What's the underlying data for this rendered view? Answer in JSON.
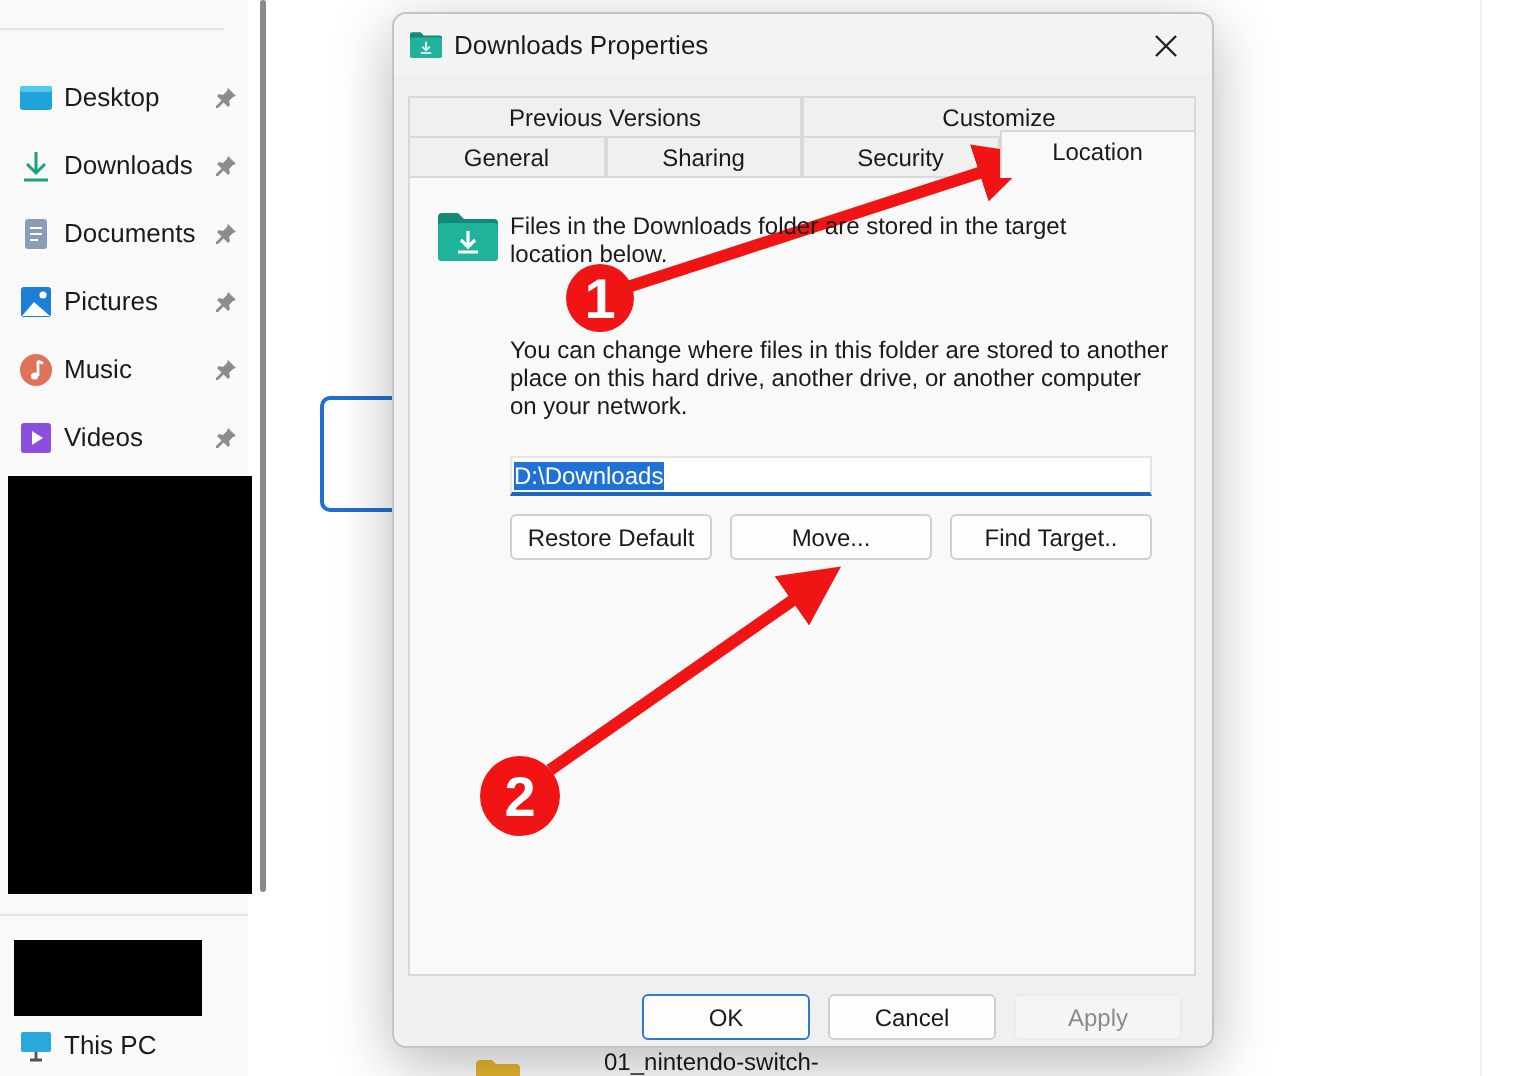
{
  "sidebar": {
    "items": [
      {
        "label": "Desktop",
        "pinned": true
      },
      {
        "label": "Downloads",
        "pinned": true
      },
      {
        "label": "Documents",
        "pinned": true
      },
      {
        "label": "Pictures",
        "pinned": true
      },
      {
        "label": "Music",
        "pinned": true
      },
      {
        "label": "Videos",
        "pinned": true
      }
    ],
    "bottom_items": [
      {
        "label": "This PC",
        "pinned": false
      }
    ]
  },
  "file_list": {
    "items": [
      {
        "label": "01_nintendo-switch-"
      }
    ]
  },
  "dialog": {
    "title": "Downloads Properties",
    "tab_rows": [
      {
        "tabs": [
          {
            "label": "Previous Versions",
            "selected": false
          },
          {
            "label": "Customize",
            "selected": false
          }
        ]
      },
      {
        "tabs": [
          {
            "label": "General",
            "selected": false
          },
          {
            "label": "Sharing",
            "selected": false
          },
          {
            "label": "Security",
            "selected": false
          },
          {
            "label": "Location",
            "selected": true
          }
        ]
      }
    ],
    "intro": "Files in the Downloads folder are stored in the target location below.",
    "description": "You can change where files in this folder are stored to another place on this hard drive, another drive, or another computer on your network.",
    "path_field": {
      "value": "D:\\Downloads",
      "text_selected": true
    },
    "location_buttons": [
      {
        "label": "Restore Default"
      },
      {
        "label": "Move..."
      },
      {
        "label": "Find Target.."
      }
    ],
    "footer_buttons": [
      {
        "label": "OK",
        "default": true,
        "disabled": false
      },
      {
        "label": "Cancel",
        "default": false,
        "disabled": false
      },
      {
        "label": "Apply",
        "default": false,
        "disabled": true
      }
    ]
  },
  "annotations": [
    {
      "label": "1"
    },
    {
      "label": "2"
    }
  ]
}
